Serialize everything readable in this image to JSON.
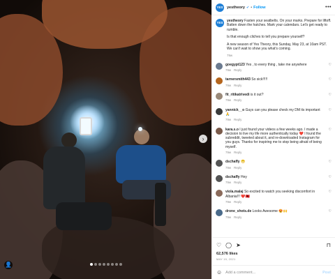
{
  "post_image": {
    "description_icon": "user-tag-icon",
    "next_icon": "chevron-right-icon",
    "dots_count": 8
  },
  "header": {
    "avatar_text": "YES",
    "username": "yestheory",
    "verified_icon": "verified-icon",
    "separator": "•",
    "follow_label": "Follow",
    "more_icon": "•••"
  },
  "caption": {
    "username": "yestheory",
    "paragraphs": [
      "Fasten your seatbelts. On your marks. Prepare for liftoff. Batten down the hatches. Mark your calendars. Let's get ready to rumble.",
      "Is that enough cliches to tell you prepare yourself?",
      "A new season of Yes Theory, this Sunday, May 23, at 10am PST. We can't wait to show you what's coming."
    ],
    "time": "79w"
  },
  "comments": [
    {
      "username": "goegypt123",
      "text": "Yes , to every thing , take me anywhere",
      "time": "79w",
      "reply": "Reply",
      "avatar_color": "#6b7a8f"
    },
    {
      "username": "tarnersmith443",
      "text": "So sick!!!!!",
      "time": "79w",
      "reply": "Reply",
      "avatar_color": "#b5651d"
    },
    {
      "username": "fit_ritikatrivedi",
      "text": "is it out?",
      "time": "79w",
      "reply": "Reply",
      "avatar_color": "#9a8a7a"
    },
    {
      "username": "yannick__o",
      "text": "Guys can you please check my DM its important 🙏",
      "time": "79w",
      "reply": "Reply",
      "avatar_color": "#3a3a3a"
    },
    {
      "username": "kara.s.o",
      "text": "I just found your videos a few weeks ago. I made a decision to live my life more authentically today ❤️ I found the subreddit, tweeted about it, and re-downloaded Instagram for you guys. Thanks for inspiring me to stop being afraid of being myself.",
      "time": "79w",
      "reply": "Reply",
      "avatar_color": "#7a5a4a"
    },
    {
      "username": "dschaffy",
      "text": "😁",
      "time": "79w",
      "reply": "Reply",
      "avatar_color": "#555555"
    },
    {
      "username": "dschaffy",
      "text": "Hey",
      "time": "79w",
      "reply": "Reply",
      "avatar_color": "#555555"
    },
    {
      "username": "viola.malaj",
      "text": "So excited to watch you seeking discomfort in Albania!!! ❤️🇦🇱",
      "time": "79w",
      "reply": "Reply",
      "avatar_color": "#8a6a5a"
    },
    {
      "username": "drone_shots.de",
      "text": "Looks Awesome 😍🙌",
      "time": "79w",
      "reply": "Reply",
      "avatar_color": "#4a6a8a"
    }
  ],
  "actions": {
    "like_icon": "♡",
    "comment_icon": "◯",
    "share_icon": "➤",
    "save_icon": "⊓",
    "likes": "62,576 likes",
    "date": "MAY 19, 2021"
  },
  "add_comment": {
    "emoji_icon": "☺",
    "placeholder": "Add a comment...",
    "post_label": "Post"
  }
}
